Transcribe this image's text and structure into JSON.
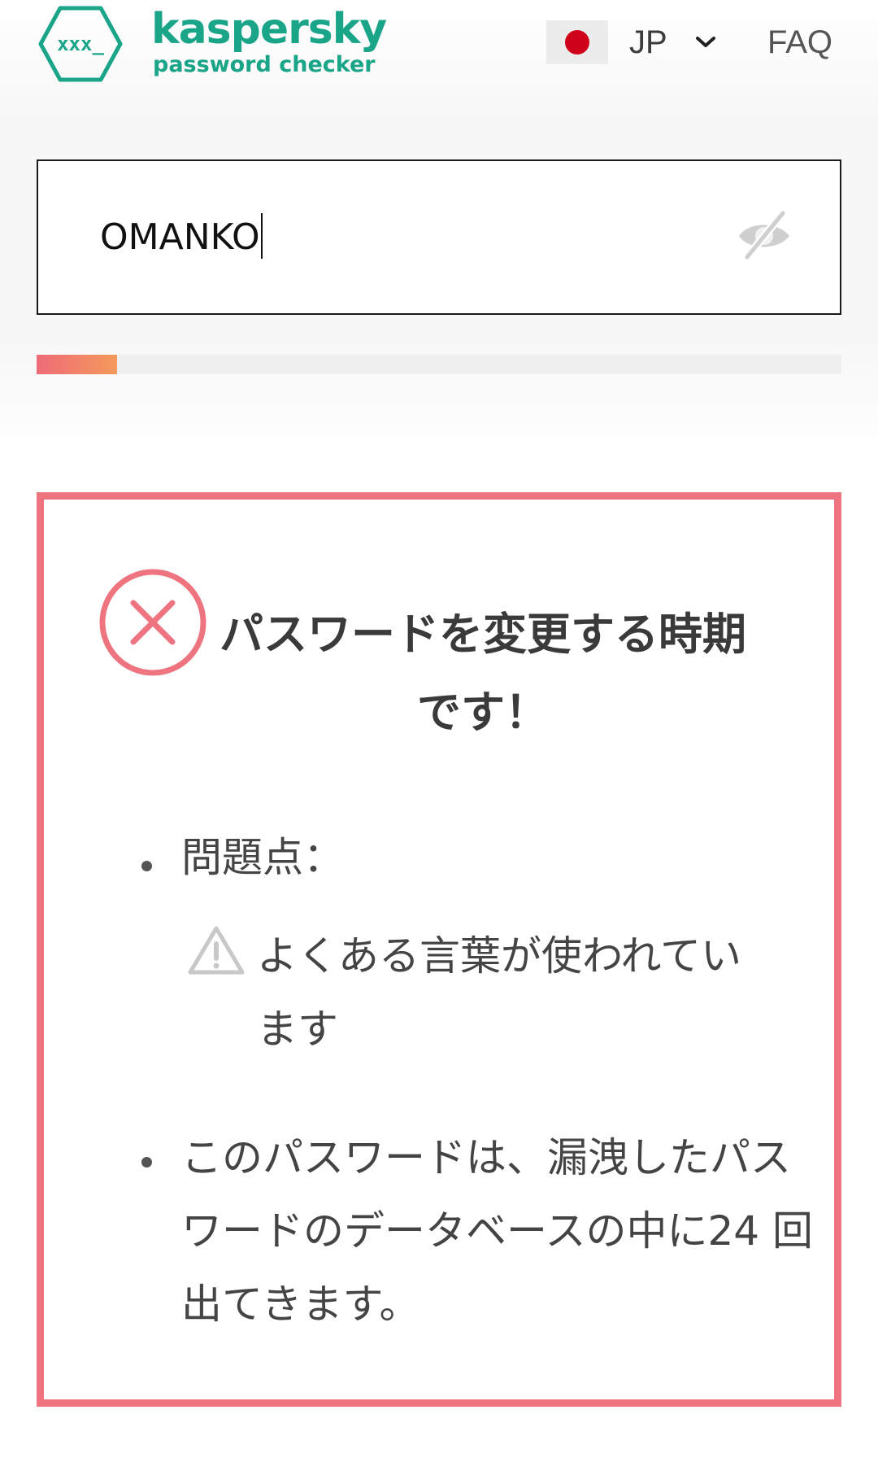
{
  "header": {
    "brand_name": "kaspersky",
    "brand_sub": "password checker",
    "logo_text": "xxx_",
    "language": {
      "code": "JP",
      "flag": "japan-flag"
    },
    "faq_label": "FAQ"
  },
  "password_field": {
    "value": "OMANKO",
    "visibility_icon": "eye-slash-icon"
  },
  "strength": {
    "level": 0.1,
    "colors": [
      "#ee6b78",
      "#f49a5b"
    ]
  },
  "result": {
    "status_icon": "error-circle-x-icon",
    "headline": "パスワードを変更する時期です！",
    "issues_label": "問題点：",
    "issue_common_word": "よくある言葉が使われています",
    "breach_message": "このパスワードは、漏洩したパスワードのデータベースの中に24 回出てきます。"
  },
  "colors": {
    "brand": "#1aa589",
    "alert_border": "#ee7480",
    "flag_red": "#d0021b"
  }
}
